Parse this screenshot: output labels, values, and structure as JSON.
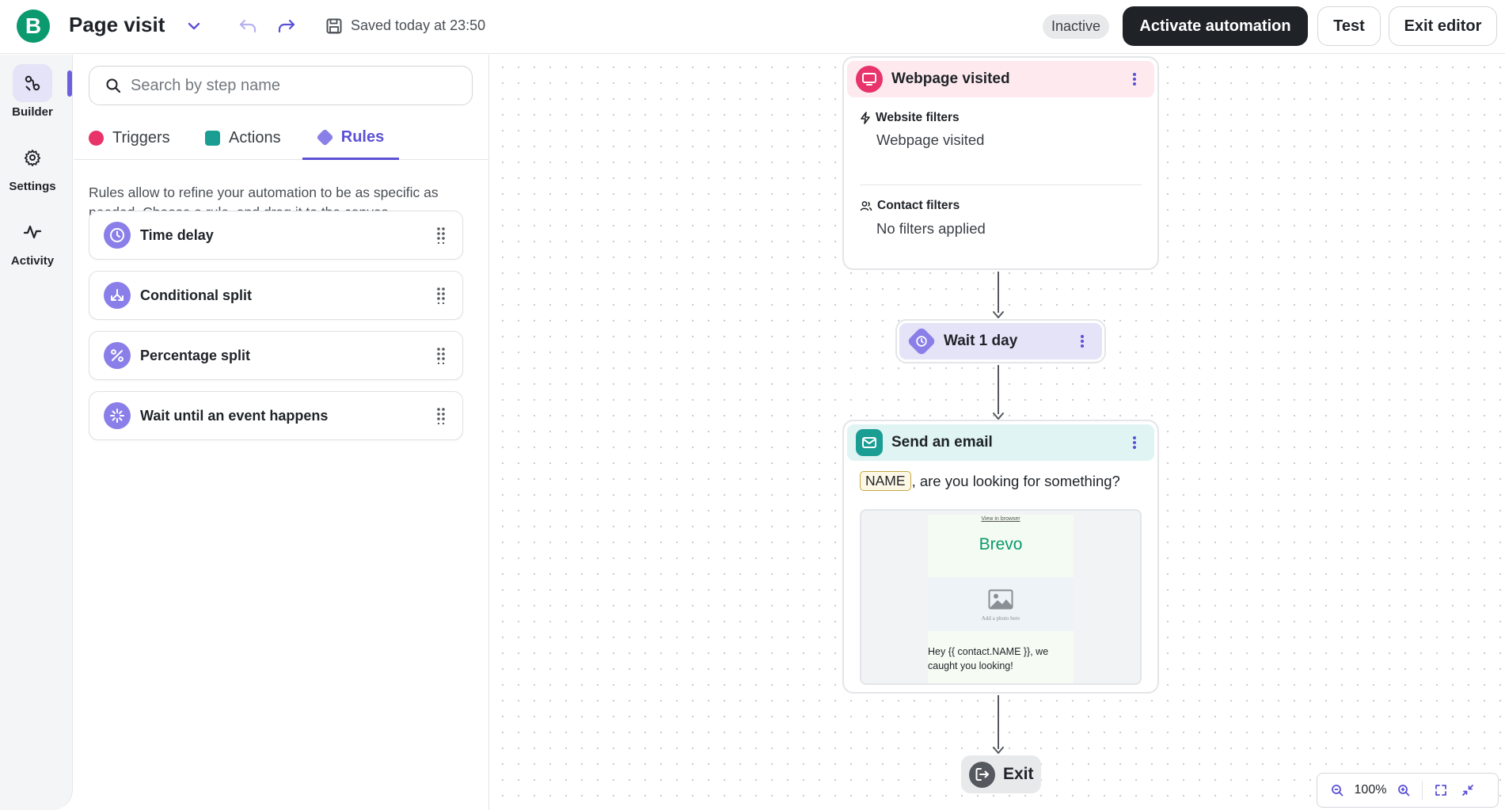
{
  "header": {
    "logo_letter": "B",
    "title": "Page visit",
    "saved_text": "Saved today at 23:50",
    "status": "Inactive",
    "activate_label": "Activate automation",
    "test_label": "Test",
    "exit_label": "Exit editor"
  },
  "rail": {
    "items": [
      {
        "label": "Builder",
        "active": true
      },
      {
        "label": "Settings",
        "active": false
      },
      {
        "label": "Activity",
        "active": false
      }
    ]
  },
  "panel": {
    "search_placeholder": "Search by step name",
    "tabs": [
      {
        "label": "Triggers",
        "color": "#e8336b"
      },
      {
        "label": "Actions",
        "color": "#1a9d93"
      },
      {
        "label": "Rules",
        "color": "#8a7fe8",
        "active": true
      }
    ],
    "description": "Rules allow to refine your automation to be as specific as needed. Choose a rule, and drag it to the canvas.",
    "rules": [
      {
        "label": "Time delay",
        "icon": "clock-icon"
      },
      {
        "label": "Conditional split",
        "icon": "split-arrows-icon"
      },
      {
        "label": "Percentage split",
        "icon": "percent-icon"
      },
      {
        "label": "Wait until an event happens",
        "icon": "sparkle-icon"
      }
    ]
  },
  "canvas": {
    "trigger": {
      "title": "Webpage visited",
      "website_filters_label": "Website filters",
      "website_filters_value": "Webpage visited",
      "contact_filters_label": "Contact filters",
      "contact_filters_value": "No filters applied"
    },
    "wait": {
      "title": "Wait 1 day"
    },
    "email": {
      "title": "Send an email",
      "subject_tag": "NAME",
      "subject_rest": ", are you looking for something?",
      "preview_link": "View in browser",
      "preview_brand": "Brevo",
      "preview_photo_text": "Add a photo here",
      "preview_body": "Hey {{ contact.NAME }}, we caught you looking!"
    },
    "exit": {
      "label": "Exit"
    },
    "zoom_level": "100%"
  },
  "colors": {
    "brand_green": "#0b996e",
    "accent_purple": "#5b50d6",
    "trigger_pink": "#e8336b",
    "action_teal": "#1a9d93",
    "rule_purple": "#8a7fe8",
    "dark": "#1f2328"
  }
}
